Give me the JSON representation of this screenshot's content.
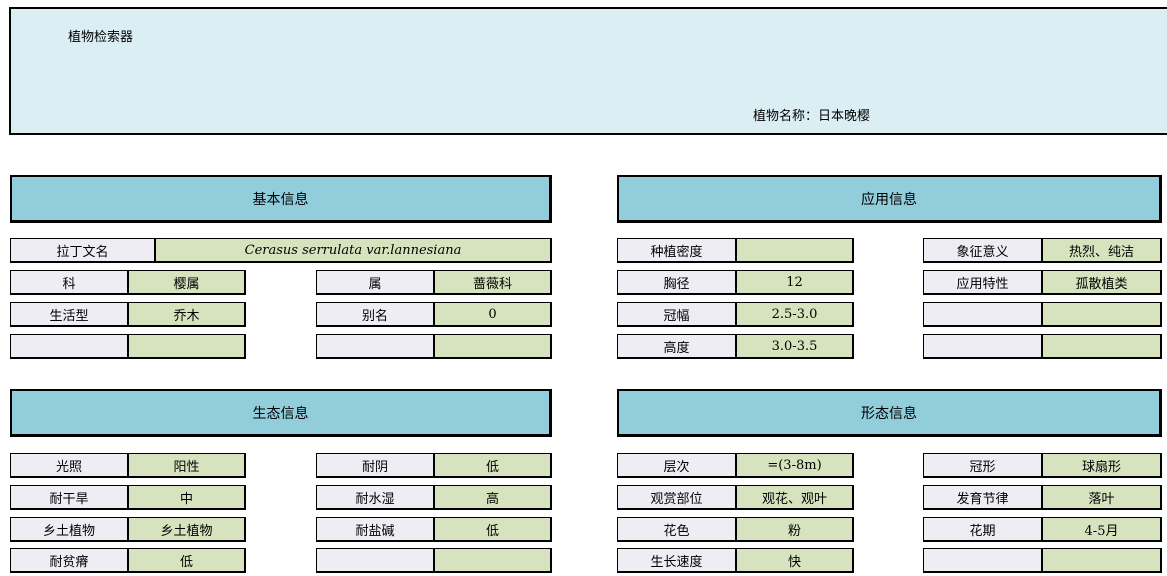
{
  "header": {
    "app_title": "植物检索器",
    "plant_name_label": "植物名称：",
    "plant_name": "日本晚樱"
  },
  "basic": {
    "title": "基本信息",
    "latin_label": "拉丁文名",
    "latin_value": "Cerasus serrulata var.lannesiana",
    "family_label": "科",
    "family_value": "樱属",
    "genus_label": "属",
    "genus_value": "蔷薇科",
    "lifeform_label": "生活型",
    "lifeform_value": "乔木",
    "alias_label": "别名",
    "alias_value": "0"
  },
  "application": {
    "title": "应用信息",
    "density_label": "种植密度",
    "density_value": "",
    "dbh_label": "胸径",
    "dbh_value": "12",
    "crown_width_label": "冠幅",
    "crown_width_value": "2.5-3.0",
    "height_label": "高度",
    "height_value": "3.0-3.5",
    "symbol_label": "象征意义",
    "symbol_value": "热烈、纯洁",
    "use_label": "应用特性",
    "use_value": "孤散植类"
  },
  "ecology": {
    "title": "生态信息",
    "light_label": "光照",
    "light_value": "阳性",
    "shade_label": "耐阴",
    "shade_value": "低",
    "drought_label": "耐干旱",
    "drought_value": "中",
    "wet_label": "耐水湿",
    "wet_value": "高",
    "native_label": "乡土植物",
    "native_value": "乡土植物",
    "salt_label": "耐盐碱",
    "salt_value": "低",
    "poor_soil_label": "耐贫瘠",
    "poor_soil_value": "低"
  },
  "morphology": {
    "title": "形态信息",
    "layer_label": "层次",
    "layer_value": "=(3-8m)",
    "ornamental_label": "观赏部位",
    "ornamental_value": "观花、观叶",
    "flower_color_label": "花色",
    "flower_color_value": "粉",
    "growth_label": "生长速度",
    "growth_value": "快",
    "crown_shape_label": "冠形",
    "crown_shape_value": "球扇形",
    "rhythm_label": "发育节律",
    "rhythm_value": "落叶",
    "bloom_label": "花期",
    "bloom_value": "4-5月"
  }
}
